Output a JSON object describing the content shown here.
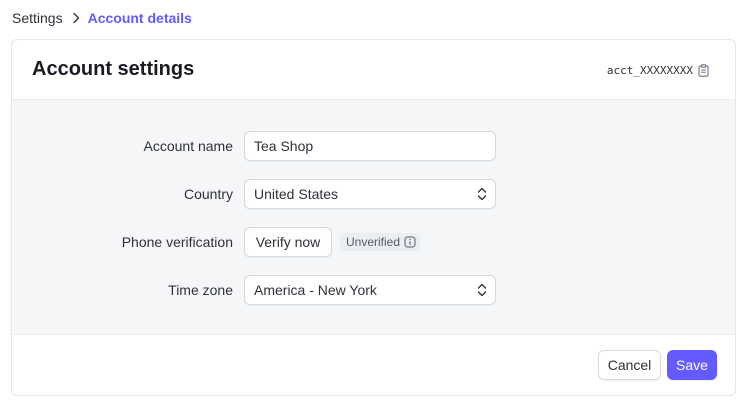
{
  "breadcrumb": {
    "root": "Settings",
    "current": "Account details"
  },
  "card": {
    "title": "Account settings",
    "account_id": "acct_XXXXXXXX"
  },
  "form": {
    "account_name": {
      "label": "Account name",
      "value": "Tea Shop"
    },
    "country": {
      "label": "Country",
      "value": "United States"
    },
    "phone": {
      "label": "Phone verification",
      "button": "Verify now",
      "badge": "Unverified"
    },
    "timezone": {
      "label": "Time zone",
      "value": "America - New York"
    }
  },
  "footer": {
    "cancel": "Cancel",
    "save": "Save"
  },
  "colors": {
    "accent": "#635bff",
    "body_bg": "#f5f6f8",
    "text": "#30313d"
  },
  "icons": [
    "chevron-right-icon",
    "clipboard-icon",
    "select-chevrons-icon",
    "info-icon"
  ]
}
